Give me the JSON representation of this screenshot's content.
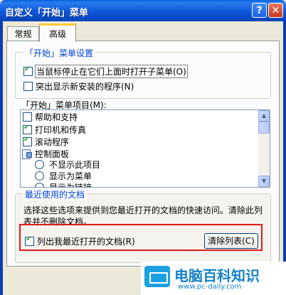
{
  "window": {
    "title": "自定义「开始」菜单",
    "help_label": "?",
    "close_label": "✕"
  },
  "tabs": [
    {
      "label": "常规"
    },
    {
      "label": "高级"
    }
  ],
  "start_menu_settings": {
    "legend": "「开始」菜单设置",
    "options": [
      {
        "label": "当鼠标停止在它们上面时打开子菜单(O)",
        "checked": true
      },
      {
        "label": "突出显示新安装的程序(N)",
        "checked": false
      }
    ]
  },
  "start_menu_items": {
    "label": "「开始」菜单项目(M):",
    "list": [
      {
        "label": "帮助和支持",
        "kind": "checkbox",
        "checked": false
      },
      {
        "label": "打印机和传真",
        "kind": "checkbox",
        "checked": true
      },
      {
        "label": "滚动程序",
        "kind": "checkbox",
        "checked": true
      },
      {
        "label": "控制面板",
        "kind": "header",
        "icon": "control-panel-icon"
      },
      {
        "label": "不显示此项目",
        "kind": "radio"
      },
      {
        "label": "显示为菜单",
        "kind": "radio"
      },
      {
        "label": "显示为链接",
        "kind": "radio"
      }
    ]
  },
  "recent_documents": {
    "legend": "最近使用的文档",
    "description": "选择这些选项来提供到您最近打开的文档的快速访问。清除此列表并不删除文档。",
    "list_recent_checkbox": {
      "label": "列出我最近打开的文档(R)",
      "checked": true
    },
    "clear_button": "清除列表(C)"
  },
  "watermark": {
    "title": "电脑百科知识",
    "url": "www.pc-daily.com"
  }
}
